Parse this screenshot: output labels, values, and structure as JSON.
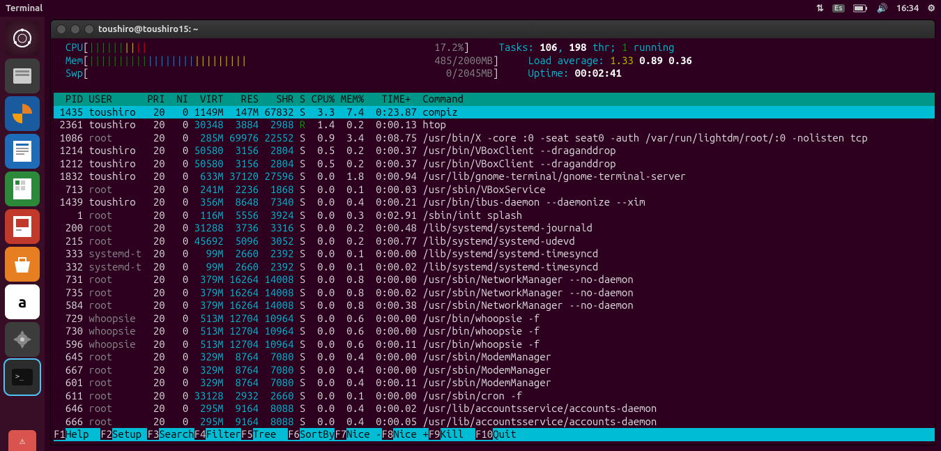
{
  "topbar": {
    "title": "Terminal",
    "lang": "Es",
    "time": "16:34"
  },
  "window": {
    "title": "toushiro@toushiro15: ~"
  },
  "meters": {
    "cpu_label": "CPU",
    "cpu_bars": "||||||||||",
    "cpu_pct": "17.2%",
    "mem_label": "Mem",
    "mem_bars": "|||||||||||||||||||||||||||",
    "mem_text": "485/2000MB",
    "swp_label": "Swp",
    "swp_text": "0/2045MB",
    "tasks_label": "Tasks: ",
    "tasks": "106",
    "thr_sep": ", ",
    "thr": "198",
    "thr_lbl": " thr; ",
    "running": "1",
    "running_lbl": " running",
    "load_label": "Load average: ",
    "l1": "1.33",
    "l2": "0.89",
    "l3": "0.36",
    "uptime_label": "Uptime: ",
    "uptime": "00:02:41"
  },
  "columns": "  PID USER      PRI  NI  VIRT   RES   SHR S CPU% MEM%   TIME+  Command",
  "selected": {
    "pid": " 1435",
    "user": "toushiro",
    "pri": "20",
    "ni": "0",
    "virt": "1149M",
    "res": " 147M",
    "shr": "67832",
    "s": "S",
    "cpu": " 3.3",
    "mem": " 7.4",
    "time": "0:23.87",
    "cmd": "compiz"
  },
  "processes": [
    {
      "pid": " 2361",
      "user": "toushiro",
      "pri": "20",
      "ni": "0",
      "virt": "30348",
      "res": " 3884",
      "shr": " 2988",
      "s": "R",
      "cpu": " 1.4",
      "mem": " 0.2",
      "time": "0:00.13",
      "cmd": "htop",
      "ucolor": "w"
    },
    {
      "pid": " 1086",
      "user": "root",
      "pri": "20",
      "ni": "0",
      "virt": " 285M",
      "res": "69976",
      "shr": "22552",
      "s": "S",
      "cpu": " 0.9",
      "mem": " 3.4",
      "time": "0:08.75",
      "cmd": "/usr/bin/X -core :0 -seat seat0 -auth /var/run/lightdm/root/:0 -nolisten tcp",
      "ucolor": "g"
    },
    {
      "pid": " 1214",
      "user": "toushiro",
      "pri": "20",
      "ni": "0",
      "virt": "50580",
      "res": " 3156",
      "shr": " 2804",
      "s": "S",
      "cpu": " 0.5",
      "mem": " 0.2",
      "time": "0:00.37",
      "cmd": "/usr/bin/VBoxClient --draganddrop",
      "ucolor": "w"
    },
    {
      "pid": " 1212",
      "user": "toushiro",
      "pri": "20",
      "ni": "0",
      "virt": "50580",
      "res": " 3156",
      "shr": " 2804",
      "s": "S",
      "cpu": " 0.5",
      "mem": " 0.2",
      "time": "0:00.37",
      "cmd": "/usr/bin/VBoxClient --draganddrop",
      "ucolor": "w"
    },
    {
      "pid": " 1832",
      "user": "toushiro",
      "pri": "20",
      "ni": "0",
      "virt": " 633M",
      "res": "37120",
      "shr": "27596",
      "s": "S",
      "cpu": " 0.0",
      "mem": " 1.8",
      "time": "0:00.94",
      "cmd": "/usr/lib/gnome-terminal/gnome-terminal-server",
      "ucolor": "w"
    },
    {
      "pid": "  713",
      "user": "root",
      "pri": "20",
      "ni": "0",
      "virt": " 241M",
      "res": " 2236",
      "shr": " 1868",
      "s": "S",
      "cpu": " 0.0",
      "mem": " 0.1",
      "time": "0:00.03",
      "cmd": "/usr/sbin/VBoxService",
      "ucolor": "g"
    },
    {
      "pid": " 1439",
      "user": "toushiro",
      "pri": "20",
      "ni": "0",
      "virt": " 356M",
      "res": " 8648",
      "shr": " 7340",
      "s": "S",
      "cpu": " 0.0",
      "mem": " 0.4",
      "time": "0:00.21",
      "cmd": "/usr/bin/ibus-daemon --daemonize --xim",
      "ucolor": "w"
    },
    {
      "pid": "    1",
      "user": "root",
      "pri": "20",
      "ni": "0",
      "virt": " 116M",
      "res": " 5556",
      "shr": " 3924",
      "s": "S",
      "cpu": " 0.0",
      "mem": " 0.3",
      "time": "0:02.91",
      "cmd": "/sbin/init splash",
      "ucolor": "g"
    },
    {
      "pid": "  200",
      "user": "root",
      "pri": "20",
      "ni": "0",
      "virt": "31288",
      "res": " 3736",
      "shr": " 3316",
      "s": "S",
      "cpu": " 0.0",
      "mem": " 0.2",
      "time": "0:00.48",
      "cmd": "/lib/systemd/systemd-journald",
      "ucolor": "g"
    },
    {
      "pid": "  215",
      "user": "root",
      "pri": "20",
      "ni": "0",
      "virt": "45692",
      "res": " 5096",
      "shr": " 3052",
      "s": "S",
      "cpu": " 0.0",
      "mem": " 0.2",
      "time": "0:00.77",
      "cmd": "/lib/systemd/systemd-udevd",
      "ucolor": "g"
    },
    {
      "pid": "  333",
      "user": "systemd-t",
      "pri": "20",
      "ni": "0",
      "virt": "  99M",
      "res": " 2660",
      "shr": " 2392",
      "s": "S",
      "cpu": " 0.0",
      "mem": " 0.1",
      "time": "0:00.00",
      "cmd": "/lib/systemd/systemd-timesyncd",
      "ucolor": "g"
    },
    {
      "pid": "  332",
      "user": "systemd-t",
      "pri": "20",
      "ni": "0",
      "virt": "  99M",
      "res": " 2660",
      "shr": " 2392",
      "s": "S",
      "cpu": " 0.0",
      "mem": " 0.1",
      "time": "0:00.02",
      "cmd": "/lib/systemd/systemd-timesyncd",
      "ucolor": "g"
    },
    {
      "pid": "  731",
      "user": "root",
      "pri": "20",
      "ni": "0",
      "virt": " 379M",
      "res": "16264",
      "shr": "14008",
      "s": "S",
      "cpu": " 0.0",
      "mem": " 0.8",
      "time": "0:00.00",
      "cmd": "/usr/sbin/NetworkManager --no-daemon",
      "ucolor": "g"
    },
    {
      "pid": "  735",
      "user": "root",
      "pri": "20",
      "ni": "0",
      "virt": " 379M",
      "res": "16264",
      "shr": "14008",
      "s": "S",
      "cpu": " 0.0",
      "mem": " 0.8",
      "time": "0:00.02",
      "cmd": "/usr/sbin/NetworkManager --no-daemon",
      "ucolor": "g"
    },
    {
      "pid": "  584",
      "user": "root",
      "pri": "20",
      "ni": "0",
      "virt": " 379M",
      "res": "16264",
      "shr": "14008",
      "s": "S",
      "cpu": " 0.0",
      "mem": " 0.8",
      "time": "0:00.38",
      "cmd": "/usr/sbin/NetworkManager --no-daemon",
      "ucolor": "g"
    },
    {
      "pid": "  729",
      "user": "whoopsie",
      "pri": "20",
      "ni": "0",
      "virt": " 513M",
      "res": "12704",
      "shr": "10964",
      "s": "S",
      "cpu": " 0.0",
      "mem": " 0.6",
      "time": "0:00.00",
      "cmd": "/usr/bin/whoopsie -f",
      "ucolor": "g"
    },
    {
      "pid": "  730",
      "user": "whoopsie",
      "pri": "20",
      "ni": "0",
      "virt": " 513M",
      "res": "12704",
      "shr": "10964",
      "s": "S",
      "cpu": " 0.0",
      "mem": " 0.6",
      "time": "0:00.00",
      "cmd": "/usr/bin/whoopsie -f",
      "ucolor": "g"
    },
    {
      "pid": "  596",
      "user": "whoopsie",
      "pri": "20",
      "ni": "0",
      "virt": " 513M",
      "res": "12704",
      "shr": "10964",
      "s": "S",
      "cpu": " 0.0",
      "mem": " 0.6",
      "time": "0:00.11",
      "cmd": "/usr/bin/whoopsie -f",
      "ucolor": "g"
    },
    {
      "pid": "  645",
      "user": "root",
      "pri": "20",
      "ni": "0",
      "virt": " 329M",
      "res": " 8764",
      "shr": " 7080",
      "s": "S",
      "cpu": " 0.0",
      "mem": " 0.4",
      "time": "0:00.00",
      "cmd": "/usr/sbin/ModemManager",
      "ucolor": "g"
    },
    {
      "pid": "  667",
      "user": "root",
      "pri": "20",
      "ni": "0",
      "virt": " 329M",
      "res": " 8764",
      "shr": " 7080",
      "s": "S",
      "cpu": " 0.0",
      "mem": " 0.4",
      "time": "0:00.00",
      "cmd": "/usr/sbin/ModemManager",
      "ucolor": "g"
    },
    {
      "pid": "  601",
      "user": "root",
      "pri": "20",
      "ni": "0",
      "virt": " 329M",
      "res": " 8764",
      "shr": " 7080",
      "s": "S",
      "cpu": " 0.0",
      "mem": " 0.4",
      "time": "0:00.11",
      "cmd": "/usr/sbin/ModemManager",
      "ucolor": "g"
    },
    {
      "pid": "  611",
      "user": "root",
      "pri": "20",
      "ni": "0",
      "virt": "33128",
      "res": " 2932",
      "shr": " 2660",
      "s": "S",
      "cpu": " 0.0",
      "mem": " 0.1",
      "time": "0:00.00",
      "cmd": "/usr/sbin/cron -f",
      "ucolor": "g"
    },
    {
      "pid": "  646",
      "user": "root",
      "pri": "20",
      "ni": "0",
      "virt": " 295M",
      "res": " 9164",
      "shr": " 8088",
      "s": "S",
      "cpu": " 0.0",
      "mem": " 0.4",
      "time": "0:00.02",
      "cmd": "/usr/lib/accountsservice/accounts-daemon",
      "ucolor": "g"
    },
    {
      "pid": "  666",
      "user": "root",
      "pri": "20",
      "ni": "0",
      "virt": " 295M",
      "res": " 9164",
      "shr": " 8088",
      "s": "S",
      "cpu": " 0.0",
      "mem": " 0.4",
      "time": "0:00.05",
      "cmd": "/usr/lib/accountsservice/accounts-daemon",
      "ucolor": "g"
    }
  ],
  "fnkeys": [
    {
      "k": "F1",
      "l": "Help  "
    },
    {
      "k": "F2",
      "l": "Setup "
    },
    {
      "k": "F3",
      "l": "Search"
    },
    {
      "k": "F4",
      "l": "Filter"
    },
    {
      "k": "F5",
      "l": "Tree  "
    },
    {
      "k": "F6",
      "l": "SortBy"
    },
    {
      "k": "F7",
      "l": "Nice -"
    },
    {
      "k": "F8",
      "l": "Nice +"
    },
    {
      "k": "F9",
      "l": "Kill  "
    },
    {
      "k": "F10",
      "l": "Quit  "
    }
  ]
}
